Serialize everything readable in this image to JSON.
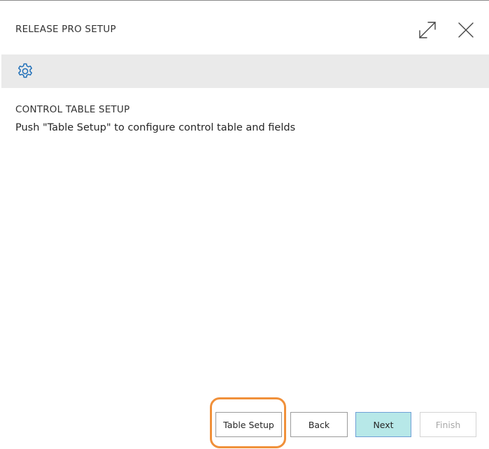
{
  "dialog": {
    "title": "RELEASE PRO SETUP",
    "expand_icon": "expand-icon",
    "close_icon": "close-icon"
  },
  "action_bar": {
    "settings_icon": "gear-icon"
  },
  "section": {
    "title": "CONTROL TABLE SETUP",
    "text": "Push \"Table Setup\" to configure control table and fields"
  },
  "footer": {
    "table_setup_label": "Table Setup",
    "back_label": "Back",
    "next_label": "Next",
    "finish_label": "Finish"
  },
  "colors": {
    "next_button_bg": "#b7e8e8",
    "next_button_border": "#6f9fd6",
    "highlight_ring": "#f0903a",
    "action_bar_bg": "#eaeaea",
    "gear_icon": "#1f6fb8"
  }
}
